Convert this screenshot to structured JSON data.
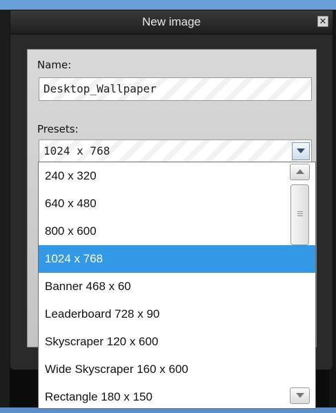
{
  "dialog": {
    "title": "New image",
    "close_glyph": "✕"
  },
  "name_field": {
    "label": "Name:",
    "value": "Desktop_Wallpaper"
  },
  "presets": {
    "label": "Presets:",
    "selected_value": "1024 x 768",
    "options": [
      "240 x 320",
      "640 x 480",
      "800 x 600",
      "1024 x 768",
      "Banner 468 x 60",
      "Leaderboard 728 x 90",
      "Skyscraper 120 x 600",
      "Wide Skyscraper 160 x 600",
      "Rectangle 180 x 150"
    ],
    "highlighted_index": 3
  },
  "colors": {
    "highlight": "#3399e6",
    "dialog_bg": "#2a2a2a",
    "panel_bg": "#d0d0d0",
    "accent_blue": "#6aa0d8"
  },
  "icons": {
    "close": "close-icon",
    "dropdown_arrow": "chevron-down-icon",
    "scroll_up": "chevron-up-icon",
    "scroll_down": "chevron-down-icon",
    "thumb_grip": "grip-icon"
  }
}
